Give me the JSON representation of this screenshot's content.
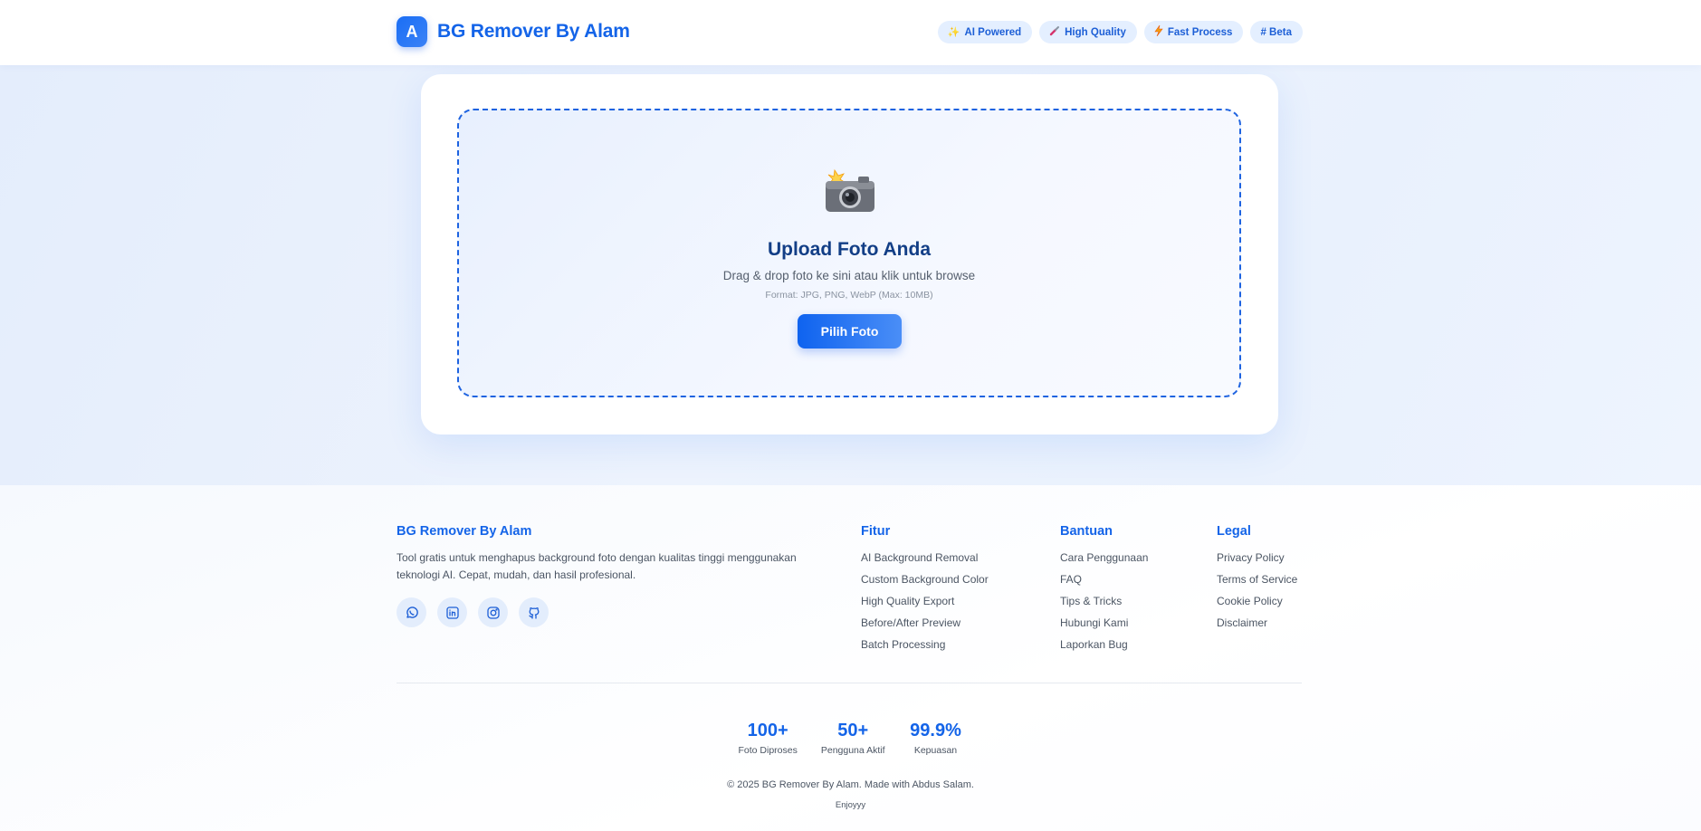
{
  "header": {
    "logo_letter": "A",
    "brand": "BG Remover By Alam",
    "badges": [
      {
        "icon": "sparkles-icon",
        "label": "AI Powered"
      },
      {
        "icon": "paint-brush-icon",
        "label": "High Quality"
      },
      {
        "icon": "lightning-icon",
        "label": "Fast Process"
      },
      {
        "icon": "hash",
        "label": "# Beta"
      }
    ]
  },
  "upload": {
    "icon": "camera-flash-icon",
    "title": "Upload Foto Anda",
    "subtitle": "Drag & drop foto ke sini atau klik untuk browse",
    "format": "Format: JPG, PNG, WebP (Max: 10MB)",
    "button": "Pilih Foto"
  },
  "footer": {
    "brand": {
      "title": "BG Remover By Alam",
      "description": "Tool gratis untuk menghapus background foto dengan kualitas tinggi menggunakan teknologi AI. Cepat, mudah, dan hasil profesional.",
      "socials": [
        "whatsapp-icon",
        "linkedin-icon",
        "instagram-icon",
        "github-icon"
      ]
    },
    "fitur": {
      "title": "Fitur",
      "items": [
        "AI Background Removal",
        "Custom Background Color",
        "High Quality Export",
        "Before/After Preview",
        "Batch Processing"
      ]
    },
    "bantuan": {
      "title": "Bantuan",
      "items": [
        "Cara Penggunaan",
        "FAQ",
        "Tips & Tricks",
        "Hubungi Kami",
        "Laporkan Bug"
      ]
    },
    "legal": {
      "title": "Legal",
      "items": [
        "Privacy Policy",
        "Terms of Service",
        "Cookie Policy",
        "Disclaimer"
      ]
    },
    "stats": [
      {
        "value": "100+",
        "label": "Foto Diproses"
      },
      {
        "value": "50+",
        "label": "Pengguna Aktif"
      },
      {
        "value": "99.9%",
        "label": "Kepuasan"
      }
    ],
    "copyright": "© 2025 BG Remover By Alam. Made with Abdus Salam.",
    "tagline": "Enjoyyy"
  },
  "colors": {
    "primary": "#1464e8",
    "badge_bg": "#e4efff",
    "hero_bg": "#e9f1fd",
    "dropzone_border": "#1e63e0",
    "heading_dark": "#123e86"
  }
}
